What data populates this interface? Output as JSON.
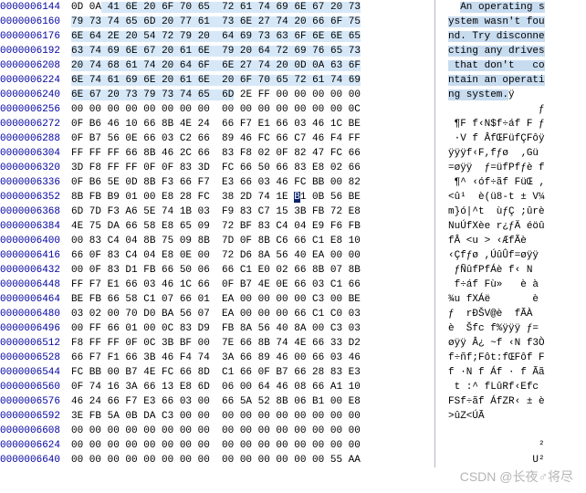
{
  "cursor": {
    "row": 13,
    "col": 12
  },
  "rows": [
    {
      "offset": "0000006144",
      "bytes": "0D 0A 41 6E 20 6F 70 65  72 61 74 69 6E 67 20 73",
      "ascii": "  An operating s",
      "hl_bytes": [
        2,
        15
      ],
      "hl_ascii": [
        2,
        15
      ]
    },
    {
      "offset": "0000006160",
      "bytes": "79 73 74 65 6D 20 77 61  73 6E 27 74 20 66 6F 75",
      "ascii": "ystem wasn't fou",
      "hl_bytes": [
        0,
        15
      ],
      "hl_ascii": [
        0,
        15
      ]
    },
    {
      "offset": "0000006176",
      "bytes": "6E 64 2E 20 54 72 79 20  64 69 73 63 6F 6E 6E 65",
      "ascii": "nd. Try disconne",
      "hl_bytes": [
        0,
        15
      ],
      "hl_ascii": [
        0,
        15
      ]
    },
    {
      "offset": "0000006192",
      "bytes": "63 74 69 6E 67 20 61 6E  79 20 64 72 69 76 65 73",
      "ascii": "cting any drives",
      "hl_bytes": [
        0,
        15
      ],
      "hl_ascii": [
        0,
        15
      ]
    },
    {
      "offset": "0000006208",
      "bytes": "20 74 68 61 74 20 64 6F  6E 27 74 20 0D 0A 63 6F",
      "ascii": " that don't   co",
      "hl_bytes": [
        0,
        15
      ],
      "hl_ascii": [
        0,
        15
      ]
    },
    {
      "offset": "0000006224",
      "bytes": "6E 74 61 69 6E 20 61 6E  20 6F 70 65 72 61 74 69",
      "ascii": "ntain an operati",
      "hl_bytes": [
        0,
        15
      ],
      "hl_ascii": [
        0,
        15
      ]
    },
    {
      "offset": "0000006240",
      "bytes": "6E 67 20 73 79 73 74 65  6D 2E FF 00 00 00 00 00",
      "ascii": "ng system.ÿ     ",
      "hl_bytes": [
        0,
        8
      ],
      "hl_ascii": [
        0,
        9
      ]
    },
    {
      "offset": "0000006256",
      "bytes": "00 00 00 00 00 00 00 00  00 00 00 00 00 00 00 0C",
      "ascii": "               ƒ"
    },
    {
      "offset": "0000006272",
      "bytes": "0F B6 46 10 66 8B 4E 24  66 F7 E1 66 03 46 1C BE",
      "ascii": " ¶F f‹N$f÷áf F ƒ"
    },
    {
      "offset": "0000006288",
      "bytes": "0F B7 56 0E 66 03 C2 66  89 46 FC 66 C7 46 F4 FF",
      "ascii": " ·V f ÂfŒFüfÇFôÿ"
    },
    {
      "offset": "0000006304",
      "bytes": "FF FF FF 66 8B 46 2C 66  83 F8 02 0F 82 47 FC 66",
      "ascii": "ÿÿÿf‹F,fƒø  ‚Gü"
    },
    {
      "offset": "0000006320",
      "bytes": "3D F8 FF FF 0F 0F 83 3D  FC 66 50 66 83 E8 02 66",
      "ascii": "=øÿÿ  ƒ=üfPfƒè f"
    },
    {
      "offset": "0000006336",
      "bytes": "0F B6 5E 0D 8B F3 66 F7  E3 66 03 46 FC BB 00 82",
      "ascii": " ¶^ ‹óf÷ãf FüŒ ‚"
    },
    {
      "offset": "0000006352",
      "bytes": "8B FB B9 01 00 E8 28 FC  38 2D 74 1E B1 0B 56 BE",
      "ascii": "<û¹  è(ü8-t ± V¼"
    },
    {
      "offset": "0000006368",
      "bytes": "6D 7D F3 A6 5E 74 1B 03  F9 83 C7 15 3B FB 72 E8",
      "ascii": "m}ó|^t  ùƒÇ ;ûrè"
    },
    {
      "offset": "0000006384",
      "bytes": "4E 75 DA 66 58 E8 65 09  72 BF 83 C4 04 E9 F6 FB",
      "ascii": "NuÚfXèe r¿ƒÄ éöû"
    },
    {
      "offset": "0000006400",
      "bytes": "00 83 C4 04 8B 75 09 8B  7D 0F 8B C6 66 C1 E8 10",
      "ascii": "fÂ <u > ‹ÆfÃè  "
    },
    {
      "offset": "0000006416",
      "bytes": "66 0F 83 C4 04 E8 0E 00  72 D6 8A 56 40 EA 00 00",
      "ascii": "‹Çfƒø ,ÚûÛf=øÿÿ"
    },
    {
      "offset": "0000006432",
      "bytes": "00 0F 83 D1 FB 66 50 06  66 C1 E0 02 66 8B 07 8B",
      "ascii": " ƒÑûfPfÁè f‹ N"
    },
    {
      "offset": "0000006448",
      "bytes": "FF F7 E1 66 03 46 1C 66  0F B7 4E 0E 66 03 C1 66",
      "ascii": " f÷áf Fù»   è à"
    },
    {
      "offset": "0000006464",
      "bytes": "BE FB 66 58 C1 07 66 01  EA 00 00 00 00 C3 00 BE",
      "ascii": "¾u fXÁë       è"
    },
    {
      "offset": "0000006480",
      "bytes": "03 02 00 70 D0 BA 56 07  EA 00 00 00 66 C1 C0 03",
      "ascii": "ƒ  rÐŠV@è  fÃÀ "
    },
    {
      "offset": "0000006496",
      "bytes": "00 FF 66 01 00 0C 83 D9  FB 8A 56 40 8A 00 C3 03",
      "ascii": "è  Šfc f%ÿÿÿ ƒ="
    },
    {
      "offset": "0000006512",
      "bytes": "F8 FF FF 0F 0C 3B BF 00  7E 66 8B 74 4E 66 33 D2",
      "ascii": "øÿÿ Â¿ ~f ‹N f3Ò"
    },
    {
      "offset": "0000006528",
      "bytes": "66 F7 F1 66 3B 46 F4 74  3A 66 89 46 00 66 03 46",
      "ascii": "f÷ñf;Fôt:fŒFôf F"
    },
    {
      "offset": "0000006544",
      "bytes": "FC BB 00 B7 4E FC 66 8D  C1 66 0F B7 66 28 83 E3",
      "ascii": "f ·N f Áf · f Ãã"
    },
    {
      "offset": "0000006560",
      "bytes": "0F 74 16 3A 66 13 E8 6D  06 00 64 46 08 66 A1 10",
      "ascii": " t :^ fLûRf‹Efc"
    },
    {
      "offset": "0000006576",
      "bytes": "46 24 66 F7 E3 66 03 00  66 5A 52 8B 06 B1 00 E8",
      "ascii": "FSf÷ãf ÁfZR‹ ± è"
    },
    {
      "offset": "0000006592",
      "bytes": "3E FB 5A 0B DA C3 00 00  00 00 00 00 00 00 00 00",
      "ascii": ">ûZ<ÚÃ          "
    },
    {
      "offset": "0000006608",
      "bytes": "00 00 00 00 00 00 00 00  00 00 00 00 00 00 00 00",
      "ascii": "                "
    },
    {
      "offset": "0000006624",
      "bytes": "00 00 00 00 00 00 00 00  00 00 00 00 00 00 00 00",
      "ascii": "               ²"
    },
    {
      "offset": "0000006640",
      "bytes": "00 00 00 00 00 00 00 00  00 00 00 00 00 00 55 AA",
      "ascii": "              U²"
    }
  ],
  "watermark": "CSDN @长夜♂将尽"
}
